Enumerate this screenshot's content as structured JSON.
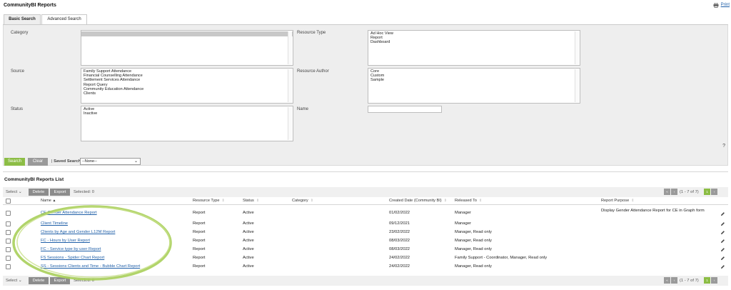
{
  "app": {
    "title": "CommunityBI Reports",
    "print_label": "Print"
  },
  "tabs": [
    {
      "label": "Basic Search",
      "active": true
    },
    {
      "label": "Advanced Search",
      "active": false
    }
  ],
  "search": {
    "category": {
      "label": "Category",
      "options": [
        ""
      ],
      "selected_index": 0
    },
    "resource_type": {
      "label": "Resource Type",
      "options": [
        "Ad Hoc View",
        "Report",
        "Dashboard"
      ]
    },
    "source": {
      "label": "Source",
      "options": [
        "Family Support Attendance",
        "Financial Counselling Attendance",
        "Settlement Services Attendance",
        "Report Query",
        "Community Education Attendance",
        "Clients"
      ]
    },
    "resource_author": {
      "label": "Resource Author",
      "options": [
        "Core",
        "Custom",
        "Sample"
      ]
    },
    "status": {
      "label": "Status",
      "options": [
        "Active",
        "Inactive"
      ]
    },
    "name": {
      "label": "Name",
      "value": ""
    },
    "help": "?",
    "search_button": "Search",
    "clear_button": "Clear",
    "saved_searches_label": "Saved Searches",
    "saved_searches_value": "--None--"
  },
  "list": {
    "title": "CommunityBI Reports List",
    "toolbar": {
      "select_label": "Select",
      "delete_label": "Delete",
      "export_label": "Export",
      "selected_label": "Selected: 0",
      "range_text": "(1 - 7 of 7)",
      "page_number": "1"
    },
    "columns": {
      "name": "Name",
      "resource_type": "Resource Type",
      "status": "Status",
      "category": "Category",
      "created_date": "Created Date (Community BI)",
      "released_to": "Released To",
      "report_purpose": "Report Purpose"
    },
    "rows": [
      {
        "name": "CE Gender Attendance Report",
        "resource_type": "Report",
        "status": "Active",
        "category": "",
        "created_date": "01/02/2022",
        "released_to": "Manager",
        "report_purpose": "Display Gender Attendance Report for CE in Graph form"
      },
      {
        "name": "Client Timeline",
        "resource_type": "Report",
        "status": "Active",
        "category": "",
        "created_date": "09/12/2021",
        "released_to": "Manager",
        "report_purpose": ""
      },
      {
        "name": "Clients by Age and Gender L12M Report",
        "resource_type": "Report",
        "status": "Active",
        "category": "",
        "created_date": "23/02/2022",
        "released_to": "Manager, Read only",
        "report_purpose": ""
      },
      {
        "name": "FC - Hours by User Report",
        "resource_type": "Report",
        "status": "Active",
        "category": "",
        "created_date": "08/03/2022",
        "released_to": "Manager, Read only",
        "report_purpose": ""
      },
      {
        "name": "FC - Service type by user Report",
        "resource_type": "Report",
        "status": "Active",
        "category": "",
        "created_date": "08/03/2022",
        "released_to": "Manager, Read only",
        "report_purpose": ""
      },
      {
        "name": "FS Sessions - Spider Chart Report",
        "resource_type": "Report",
        "status": "Active",
        "category": "",
        "created_date": "24/02/2022",
        "released_to": "Family Support - Coordinator, Manager, Read only",
        "report_purpose": ""
      },
      {
        "name": "SS - Sessions Clients and Time - Bubble Chart Report",
        "resource_type": "Report",
        "status": "Active",
        "category": "",
        "created_date": "24/02/2022",
        "released_to": "Manager, Read only",
        "report_purpose": ""
      }
    ]
  },
  "colors": {
    "accent_green": "#8cbd45",
    "button_gray": "#8c8c8c",
    "link_blue": "#1f5fa8",
    "panel_bg": "#eeeeee",
    "highlight_ring": "#a9cf5a"
  },
  "icons": {
    "print": "printer-icon",
    "edit": "pencil-icon",
    "sort": "sort-icon",
    "dropdown": "chevron-down-icon",
    "pager": [
      "first-page-icon",
      "prev-page-icon",
      "next-page-icon",
      "last-page-icon"
    ]
  }
}
